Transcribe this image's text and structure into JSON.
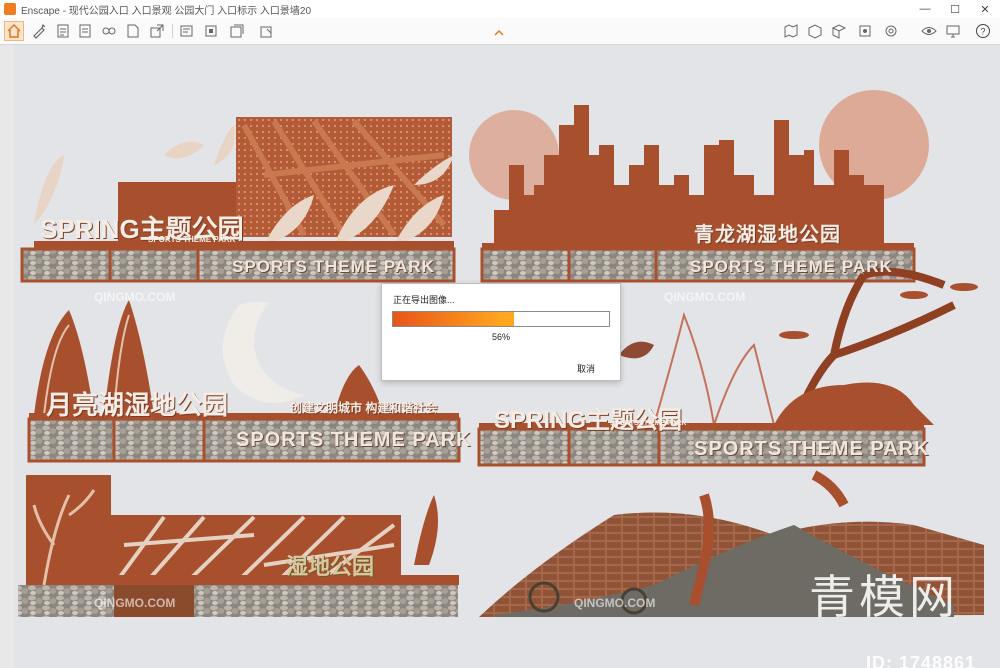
{
  "window": {
    "title": "Enscape - 现代公园入口 入口景观 公园大门 入口标示 入口景墙20",
    "minimize_glyph": "—",
    "maximize_glyph": "☐",
    "close_glyph": "✕"
  },
  "toolbar": {
    "icons": [
      "home-icon",
      "pen-icon",
      "document-icon",
      "document-icon",
      "link-icon",
      "file-icon",
      "export-icon",
      "layers-icon",
      "cube-icon",
      "cube-frame-icon",
      "chevron-up-icon",
      "map-icon",
      "box-icon",
      "cube-icon",
      "settings-icon",
      "eye-icon",
      "monitor-icon",
      "help-icon"
    ],
    "help_label": "?"
  },
  "scene": {
    "panels": [
      {
        "title": "SPRING主题公园",
        "subtitle": "SPORTS THEME PARK",
        "gabion_text": "SPORTS THEME PARK"
      },
      {
        "title": "青龙湖湿地公园",
        "gabion_text": "SPORTS THEME PARK"
      },
      {
        "title": "月亮湖湿地公园",
        "slogan": "创建文明城市 构建和谐社会",
        "gabion_text": "SPORTS THEME PARK"
      },
      {
        "title": "SPRING主题公园",
        "subtitle": "SPORTS THEME PARK",
        "gabion_text": "SPORTS THEME PARK"
      },
      {
        "title": "湿地公园"
      }
    ],
    "watermark_small": "QINGMO.COM",
    "watermark_big": "青模网",
    "id_text": "ID: 1748861"
  },
  "dialog": {
    "title": "正在导出图像...",
    "progress_percent": 56,
    "progress_label": "56%",
    "cancel_label": "取消"
  },
  "colors": {
    "accent": "#f07d22",
    "corten": "#a8502e",
    "progress_start": "#e8541a",
    "progress_end": "#ffa61e"
  }
}
